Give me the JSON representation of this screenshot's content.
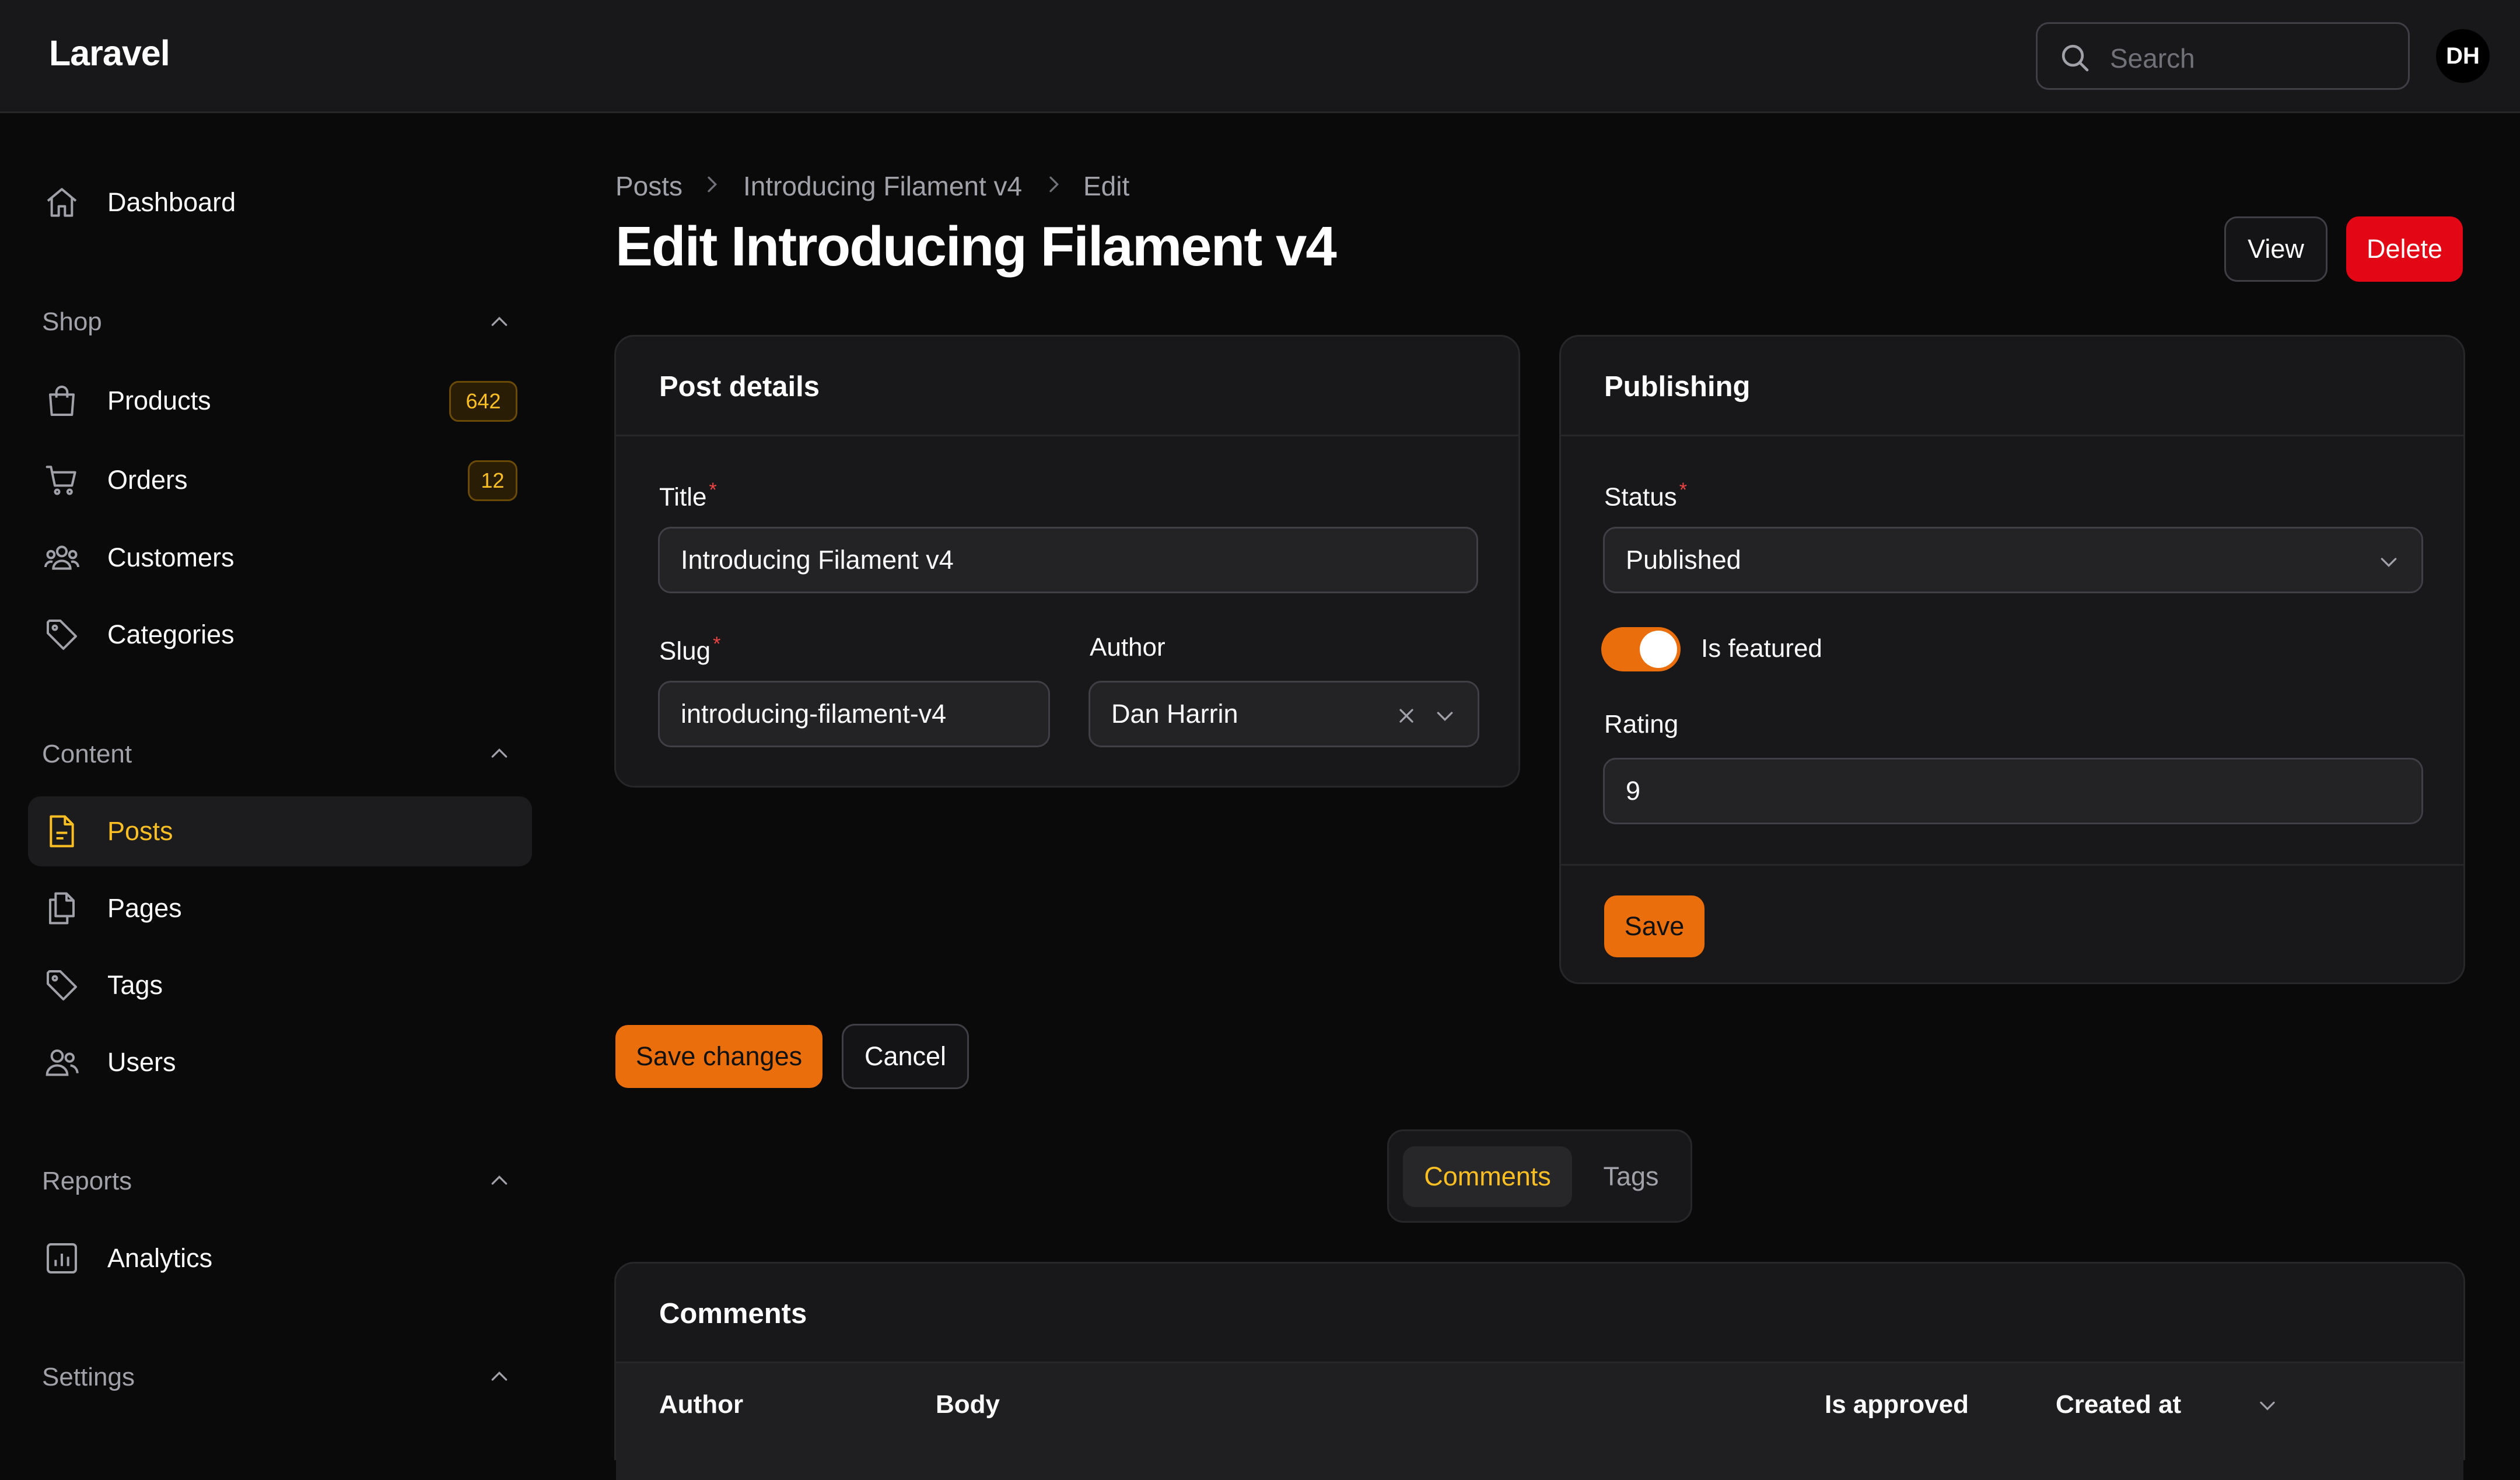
{
  "app": {
    "brand": "Laravel"
  },
  "header": {
    "search_placeholder": "Search",
    "user_initials": "DH"
  },
  "sidebar": {
    "dashboard": "Dashboard",
    "groups": {
      "shop": {
        "label": "Shop",
        "items": [
          {
            "label": "Products",
            "badge": "642"
          },
          {
            "label": "Orders",
            "badge": "12"
          },
          {
            "label": "Customers"
          },
          {
            "label": "Categories"
          }
        ]
      },
      "content": {
        "label": "Content",
        "items": [
          {
            "label": "Posts"
          },
          {
            "label": "Pages"
          },
          {
            "label": "Tags"
          },
          {
            "label": "Users"
          }
        ]
      },
      "reports": {
        "label": "Reports",
        "items": [
          {
            "label": "Analytics"
          }
        ]
      },
      "settings": {
        "label": "Settings"
      }
    }
  },
  "breadcrumb": [
    "Posts",
    "Introducing Filament v4",
    "Edit"
  ],
  "page": {
    "title": "Edit Introducing Filament v4",
    "view_label": "View",
    "delete_label": "Delete"
  },
  "post_details": {
    "heading": "Post details",
    "title_label": "Title",
    "title_value": "Introducing Filament v4",
    "slug_label": "Slug",
    "slug_value": "introducing-filament-v4",
    "author_label": "Author",
    "author_value": "Dan Harrin"
  },
  "publishing": {
    "heading": "Publishing",
    "status_label": "Status",
    "status_value": "Published",
    "featured_label": "Is featured",
    "featured_on": true,
    "rating_label": "Rating",
    "rating_value": "9",
    "save_label": "Save"
  },
  "form_actions": {
    "save_changes": "Save changes",
    "cancel": "Cancel"
  },
  "relation_tabs": [
    {
      "label": "Comments",
      "active": true
    },
    {
      "label": "Tags",
      "active": false
    }
  ],
  "comments": {
    "heading": "Comments",
    "columns": [
      "Author",
      "Body",
      "Is approved",
      "Created at"
    ]
  },
  "colors": {
    "accent": "#ea6e0b",
    "danger": "#e30614",
    "active_text": "#fbbf24"
  }
}
